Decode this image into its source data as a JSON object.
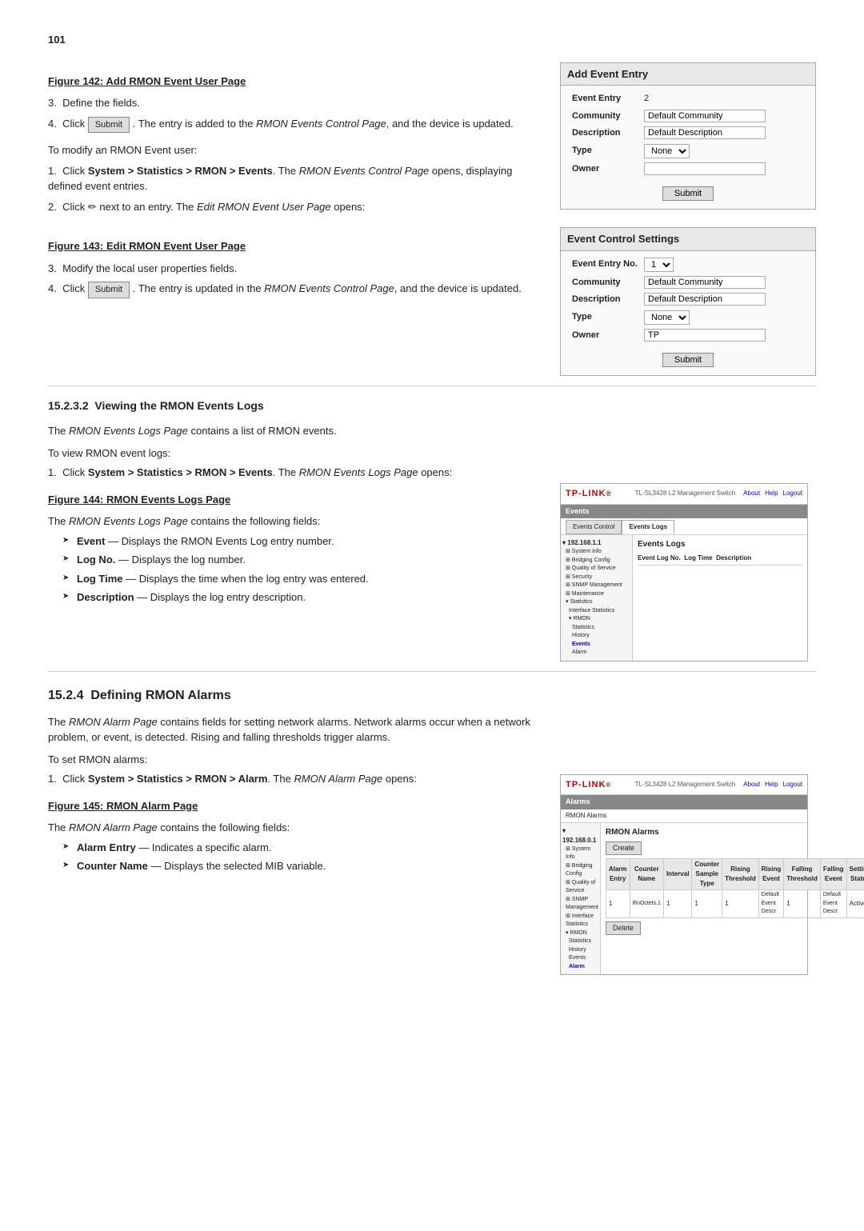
{
  "page": {
    "number": "101"
  },
  "figure142": {
    "title": "Figure 142: Add RMON Event User Page",
    "panel_title": "Add Event Entry",
    "fields": [
      {
        "label": "Event Entry",
        "value": "2",
        "type": "text"
      },
      {
        "label": "Community",
        "value": "Default Community",
        "type": "text"
      },
      {
        "label": "Description",
        "value": "Default Description",
        "type": "text"
      },
      {
        "label": "Type",
        "value": "None",
        "type": "select"
      },
      {
        "label": "Owner",
        "value": "",
        "type": "text"
      }
    ],
    "submit_label": "Submit"
  },
  "steps_add": [
    {
      "num": "3.",
      "text": "Define the fields."
    },
    {
      "num": "4.",
      "text_before": "Click",
      "btn": "Submit",
      "text_after": ". The entry is added to the",
      "italic": "RMON Events Control Page",
      "text_end": ", and the device is updated."
    }
  ],
  "modify_rmon_event": {
    "heading": "To modify an RMON Event user:",
    "steps": [
      {
        "num": "1.",
        "text_bold": "Click System > Statistics > RMON > Events",
        "text_after": ". The",
        "italic": "RMON Events Control Page",
        "text_end": "opens, displaying defined event entries."
      },
      {
        "num": "2.",
        "text_before": "Click",
        "icon": "✏",
        "text_after": "next to an entry. The",
        "italic": "Edit RMON Event User Page",
        "text_end": "opens:"
      }
    ]
  },
  "figure143": {
    "title": "Figure 143: Edit RMON Event User Page",
    "panel_title": "Event Control Settings",
    "fields": [
      {
        "label": "Event Entry No.",
        "value": "1",
        "type": "select"
      },
      {
        "label": "Community",
        "value": "Default Community",
        "type": "text"
      },
      {
        "label": "Description",
        "value": "Default Description",
        "type": "text"
      },
      {
        "label": "Type",
        "value": "None",
        "type": "select"
      },
      {
        "label": "Owner",
        "value": "TP",
        "type": "text"
      }
    ],
    "submit_label": "Submit"
  },
  "steps_edit": [
    {
      "num": "3.",
      "text": "Modify the local user properties fields."
    },
    {
      "num": "4.",
      "text_before": "Click",
      "btn": "Submit",
      "text_after": ". The entry is updated in the",
      "italic": "RMON Events Control Page",
      "text_end": ", and the device is updated."
    }
  ],
  "section_viewing": {
    "number": "15.2.3.2",
    "title": "Viewing the RMON Events Logs",
    "intro": "The",
    "italic_intro": "RMON Events Logs Page",
    "intro_rest": "contains a list of RMON events.",
    "view_heading": "To view RMON event logs:",
    "step1_text_before": "Click",
    "step1_bold": "System > Statistics > RMON > Events",
    "step1_after": ". The",
    "step1_italic": "RMON Events Logs Page",
    "step1_end": "opens:"
  },
  "figure144": {
    "title": "Figure 144: RMON Events Logs Page",
    "tplink_title": "TP-LINK",
    "model": "TL-SL3428 L2 Management Switch",
    "nav_items": [
      "Events Control",
      "Events Logs"
    ],
    "active_nav": "Events Logs",
    "section_label": "Events",
    "content_title": "Events Logs",
    "table_headers": [
      "Event Log No.",
      "Log Time",
      "Description"
    ],
    "about_label": "About",
    "help_label": "Help",
    "logout_label": "Logout",
    "sidebar_items": [
      "192.168.1.1",
      "System Info",
      "Bridging Config",
      "Quality of Service",
      "Security",
      "SNMP Management",
      "Maintenance",
      "Statistics",
      "Interface Statistics",
      "RMON",
      "Statistics",
      "History",
      "Events",
      "Alarm"
    ]
  },
  "fields_events_logs": [
    {
      "bullet": "Event",
      "em_dash": "—",
      "desc": "Displays the RMON Events Log entry number."
    },
    {
      "bullet": "Log No.",
      "em_dash": "—",
      "desc": "Displays the log number."
    },
    {
      "bullet": "Log Time",
      "em_dash": "—",
      "desc": "Displays the time when the log entry was entered."
    },
    {
      "bullet": "Description",
      "em_dash": "—",
      "desc": "Displays the log entry description."
    }
  ],
  "section_alarms": {
    "number": "15.2.4",
    "title": "Defining RMON Alarms",
    "intro": "The",
    "italic_intro": "RMON Alarm Page",
    "intro_rest": "contains fields for setting network alarms. Network alarms occur when a network problem, or event, is detected. Rising and falling thresholds trigger alarms.",
    "set_heading": "To set RMON alarms:",
    "step1_before": "Click",
    "step1_bold": "System > Statistics > RMON > Alarm",
    "step1_after": ". The",
    "step1_italic": "RMON Alarm Page",
    "step1_end": "opens:"
  },
  "figure145": {
    "title": "Figure 145: RMON Alarm Page",
    "tplink_title": "TP-LINK",
    "model": "TL-SL3428 L2 Management Switch",
    "section_label": "Alarms",
    "content_title": "RMON Alarms",
    "about_label": "About",
    "help_label": "Help",
    "logout_label": "Logout",
    "create_btn": "Create",
    "table_headers": [
      "Alarm Entry",
      "Counter Name",
      "Interval",
      "Counter Sample Type",
      "Rising Threshold",
      "Rising Event",
      "Falling Threshold",
      "Falling Event",
      "Setting Status"
    ],
    "delete_btn": "Delete",
    "sidebar_items": [
      "192.168.0.1",
      "System Info",
      "Bridging Config",
      "Quality of Service",
      "SNMP Management",
      "Interface Statistics",
      "RMON",
      "Statistics",
      "History",
      "Events",
      "Alarm"
    ]
  },
  "fields_alarms": [
    {
      "bullet": "Alarm Entry",
      "em_dash": "—",
      "desc": "Indicates a specific alarm."
    },
    {
      "bullet": "Counter Name",
      "em_dash": "—",
      "desc": "Displays the selected MIB variable."
    }
  ]
}
